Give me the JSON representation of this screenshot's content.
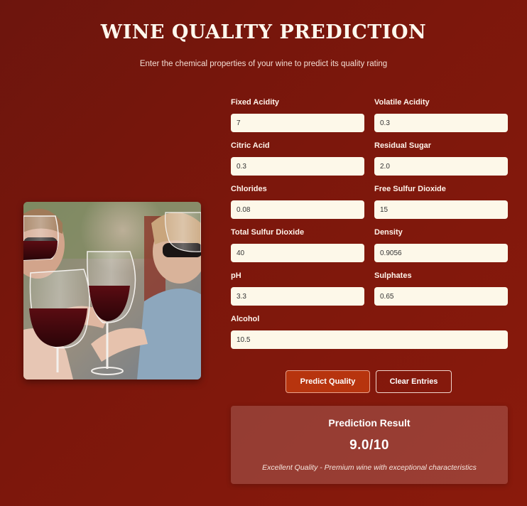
{
  "header": {
    "title": "WINE QUALITY PREDICTION",
    "subtitle": "Enter the chemical properties of your wine to predict its quality rating"
  },
  "image": {
    "subject": "wine-glasses-toast-photo"
  },
  "fields": [
    {
      "label": "Fixed Acidity",
      "value": "7"
    },
    {
      "label": "Volatile Acidity",
      "value": "0.3"
    },
    {
      "label": "Citric Acid",
      "value": "0.3"
    },
    {
      "label": "Residual Sugar",
      "value": "2.0"
    },
    {
      "label": "Chlorides",
      "value": "0.08"
    },
    {
      "label": "Free Sulfur Dioxide",
      "value": "15"
    },
    {
      "label": "Total Sulfur Dioxide",
      "value": "40"
    },
    {
      "label": "Density",
      "value": "0.9056"
    },
    {
      "label": "pH",
      "value": "3.3"
    },
    {
      "label": "Sulphates",
      "value": "0.65"
    },
    {
      "label": "Alcohol",
      "value": "10.5"
    }
  ],
  "buttons": {
    "predict": "Predict Quality",
    "clear": "Clear Entries"
  },
  "result": {
    "title": "Prediction Result",
    "score": "9.0/10",
    "description": "Excellent Quality - Premium wine with exceptional characteristics"
  },
  "colors": {
    "background": "#7c170c",
    "input_bg": "#fdf8e9",
    "predict_button": "#b7340e"
  }
}
